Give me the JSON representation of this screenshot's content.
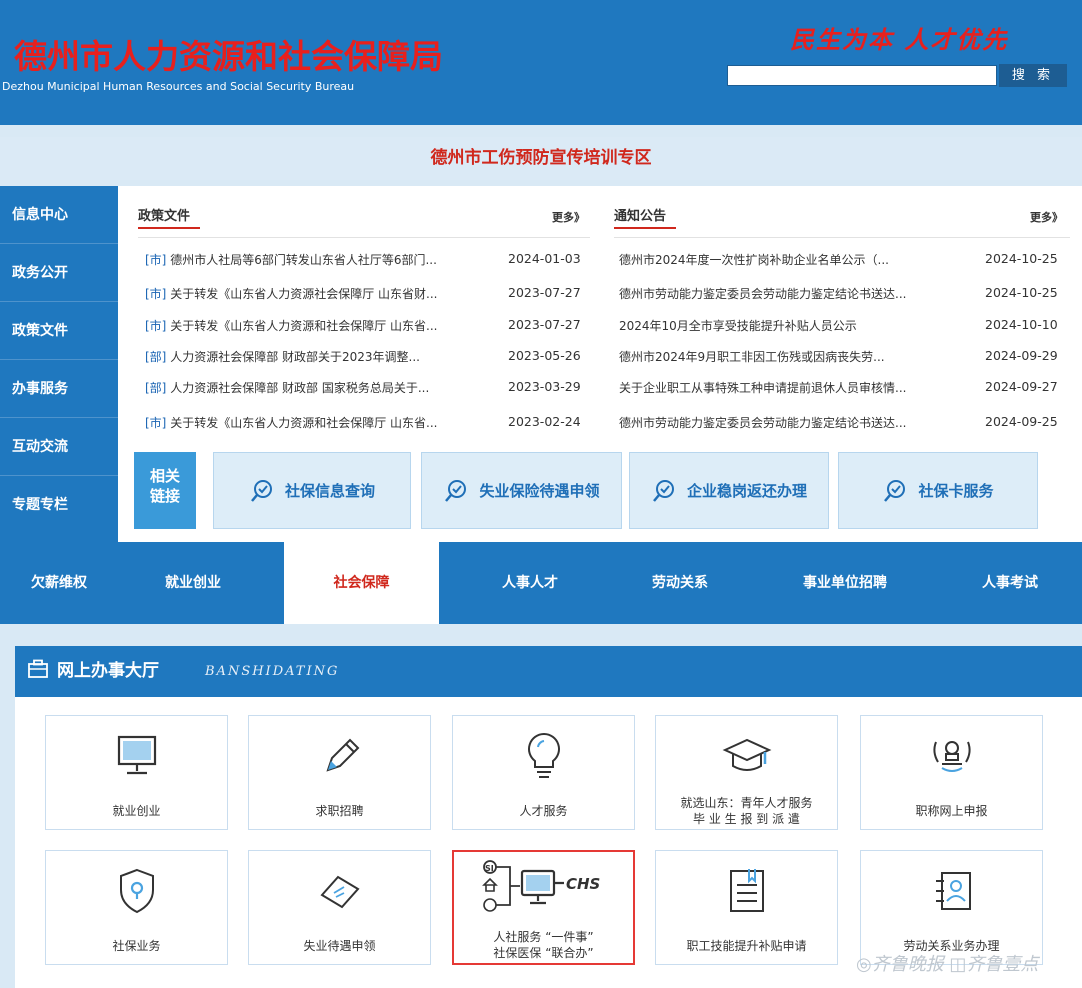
{
  "header": {
    "title_cn": "德州市人力资源和社会保障局",
    "title_en": "Dezhou Municipal Human Resources and Social Security Bureau",
    "slogan": "民生为本 人才优先",
    "search_value": "",
    "search_button": "搜 索"
  },
  "banner": "德州市工伤预防宣传培训专区",
  "left_nav": [
    "信息中心",
    "政务公开",
    "政策文件",
    "办事服务",
    "互动交流",
    "专题专栏"
  ],
  "policy": {
    "title": "政策文件",
    "more": "更多》",
    "rows": [
      {
        "tag": "[市]",
        "text": " 德州市人社局等6部门转发山东省人社厅等6部门...",
        "date": "2024-01-03"
      },
      {
        "tag": "[市]",
        "text": " 关于转发《山东省人力资源社会保障厅 山东省财...",
        "date": "2023-07-27"
      },
      {
        "tag": "[市]",
        "text": " 关于转发《山东省人力资源和社会保障厅 山东省...",
        "date": "2023-07-27"
      },
      {
        "tag": "[部]",
        "text": " 人力资源社会保障部 财政部关于2023年调整...",
        "date": "2023-05-26"
      },
      {
        "tag": "[部]",
        "text": " 人力资源社会保障部 财政部 国家税务总局关于...",
        "date": "2023-03-29"
      },
      {
        "tag": "[市]",
        "text": " 关于转发《山东省人力资源和社会保障厅 山东省...",
        "date": "2023-02-24"
      }
    ]
  },
  "notice": {
    "title": "通知公告",
    "more": "更多》",
    "rows": [
      {
        "text": "德州市2024年度一次性扩岗补助企业名单公示（...",
        "date": "2024-10-25"
      },
      {
        "text": "德州市劳动能力鉴定委员会劳动能力鉴定结论书送达...",
        "date": "2024-10-25"
      },
      {
        "text": "2024年10月全市享受技能提升补贴人员公示",
        "date": "2024-10-10"
      },
      {
        "text": "德州市2024年9月职工非因工伤残或因病丧失劳...",
        "date": "2024-09-29"
      },
      {
        "text": "关于企业职工从事特殊工种申请提前退休人员审核情...",
        "date": "2024-09-27"
      },
      {
        "text": "德州市劳动能力鉴定委员会劳动能力鉴定结论书送达...",
        "date": "2024-09-25"
      }
    ]
  },
  "related": {
    "label_line1": "相关",
    "label_line2": "链接",
    "links": [
      "社保信息查询",
      "失业保险待遇申领",
      "企业稳岗返还办理",
      "社保卡服务"
    ]
  },
  "categories": [
    "欠薪维权",
    "就业创业",
    "社会保障",
    "人事人才",
    "劳动关系",
    "事业单位招聘",
    "人事考试"
  ],
  "active_category": "社会保障",
  "hall": {
    "title": "网上办事大厅",
    "subtitle": "BANSHIDATING",
    "row1": [
      {
        "icon": "monitor-icon",
        "label": "就业创业"
      },
      {
        "icon": "pen-icon",
        "label": "求职招聘"
      },
      {
        "icon": "lightbulb-icon",
        "label": "人才服务"
      },
      {
        "icon": "graduation-cap-icon",
        "label": "就选山东：青年人才服务",
        "label2": "毕 业 生 报 到 派 遣"
      },
      {
        "icon": "stamp-icon",
        "label": "职称网上申报"
      }
    ],
    "row2": [
      {
        "icon": "shield-location-icon",
        "label": "社保业务"
      },
      {
        "icon": "ticket-icon",
        "label": "失业待遇申领"
      },
      {
        "icon": "chs-network-icon",
        "label": "人社服务 “一件事”",
        "label2": "社保医保 “联合办”",
        "chs": "CHS",
        "si": "SI"
      },
      {
        "icon": "document-icon",
        "label": "职工技能提升补贴申请"
      },
      {
        "icon": "contact-list-icon",
        "label": "劳动关系业务办理"
      }
    ]
  },
  "watermark": "◎齐鲁晚报 ◫齐鲁壹点"
}
